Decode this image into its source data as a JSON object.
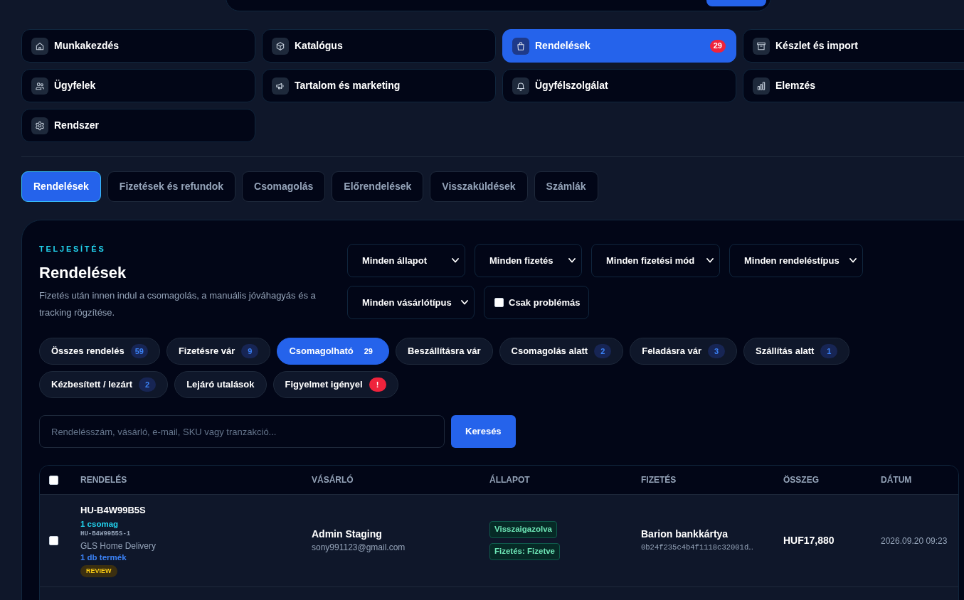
{
  "nav": [
    {
      "label": "Munkakezdés",
      "selected": false
    },
    {
      "label": "Katalógus",
      "selected": false
    },
    {
      "label": "Rendelések",
      "selected": true,
      "badge": "29"
    },
    {
      "label": "Készlet és import",
      "selected": false
    },
    {
      "label": "Ügyfelek",
      "selected": false
    },
    {
      "label": "Tartalom és marketing",
      "selected": false
    },
    {
      "label": "Ügyfélszolgálat",
      "selected": false
    },
    {
      "label": "Elemzés",
      "selected": false
    },
    {
      "label": "Rendszer",
      "selected": false
    }
  ],
  "sub_tabs": [
    {
      "label": "Rendelések",
      "selected": true
    },
    {
      "label": "Fizetések és refundok",
      "selected": false
    },
    {
      "label": "Csomagolás",
      "selected": false
    },
    {
      "label": "Előrendelések",
      "selected": false
    },
    {
      "label": "Visszaküldések",
      "selected": false
    },
    {
      "label": "Számlák",
      "selected": false
    }
  ],
  "panel": {
    "eyebrow": "TELJESÍTÉS",
    "title": "Rendelések",
    "description": "Fizetés után innen indul a csomagolás, a manuális jóváhagyás és a tracking rögzítése."
  },
  "filters": [
    {
      "kind": "select",
      "label": "Minden állapot"
    },
    {
      "kind": "select",
      "label": "Minden fizetés"
    },
    {
      "kind": "select",
      "label": "Minden fizetési mód"
    },
    {
      "kind": "select",
      "label": "Minden rendeléstípus"
    },
    {
      "kind": "select",
      "label": "Minden vásárlótípus"
    },
    {
      "kind": "checkbox",
      "label": "Csak problémás",
      "checked": false
    }
  ],
  "status_chips": [
    {
      "label": "Összes rendelés",
      "selected": false,
      "badge": {
        "kind": "count",
        "text": "59"
      }
    },
    {
      "label": "Fizetésre vár",
      "selected": false,
      "badge": {
        "kind": "count",
        "text": "9"
      }
    },
    {
      "label": "Csomagolható",
      "selected": true,
      "badge": {
        "kind": "count",
        "text": "29"
      }
    },
    {
      "label": "Beszállításra vár",
      "selected": false
    },
    {
      "label": "Csomagolás alatt",
      "selected": false,
      "badge": {
        "kind": "count",
        "text": "2"
      }
    },
    {
      "label": "Feladásra vár",
      "selected": false,
      "badge": {
        "kind": "count",
        "text": "3"
      }
    },
    {
      "label": "Szállítás alatt",
      "selected": false,
      "badge": {
        "kind": "count",
        "text": "1"
      }
    },
    {
      "label": "Kézbesített / lezárt",
      "selected": false,
      "badge": {
        "kind": "count",
        "text": "2"
      }
    },
    {
      "label": "Lejáró utalások",
      "selected": false
    },
    {
      "label": "Figyelmet igényel",
      "selected": false,
      "badge": {
        "kind": "alert",
        "text": "!"
      }
    }
  ],
  "search": {
    "placeholder": "Rendelésszám, vásárló, e-mail, SKU vagy tranzakció...",
    "button": "Keresés"
  },
  "table": {
    "select_all_checked": false,
    "columns": [
      "RENDELÉS",
      "VÁSÁRLÓ",
      "ÁLLAPOT",
      "FIZETÉS",
      "ÖSSZEG",
      "DÁTUM"
    ],
    "rows": [
      {
        "checked": false,
        "order_id": "HU-B4W99B5S",
        "packages": "1 csomag",
        "package_id": "HU-B4W99B5S-1",
        "carrier": "GLS Home Delivery",
        "items": "1 db termék",
        "tag": "REVIEW",
        "buyer_name": "Admin Staging",
        "buyer_email": "sony991123@gmail.com",
        "statuses": [
          "Visszaigazolva",
          "Fizetés: Fizetve"
        ],
        "payment_method": "Barion bankkártya",
        "transaction": "0b24f235c4b4f1118c32001d…",
        "total": "HUF17,880",
        "date": "2026.09.20 09:23"
      }
    ]
  }
}
